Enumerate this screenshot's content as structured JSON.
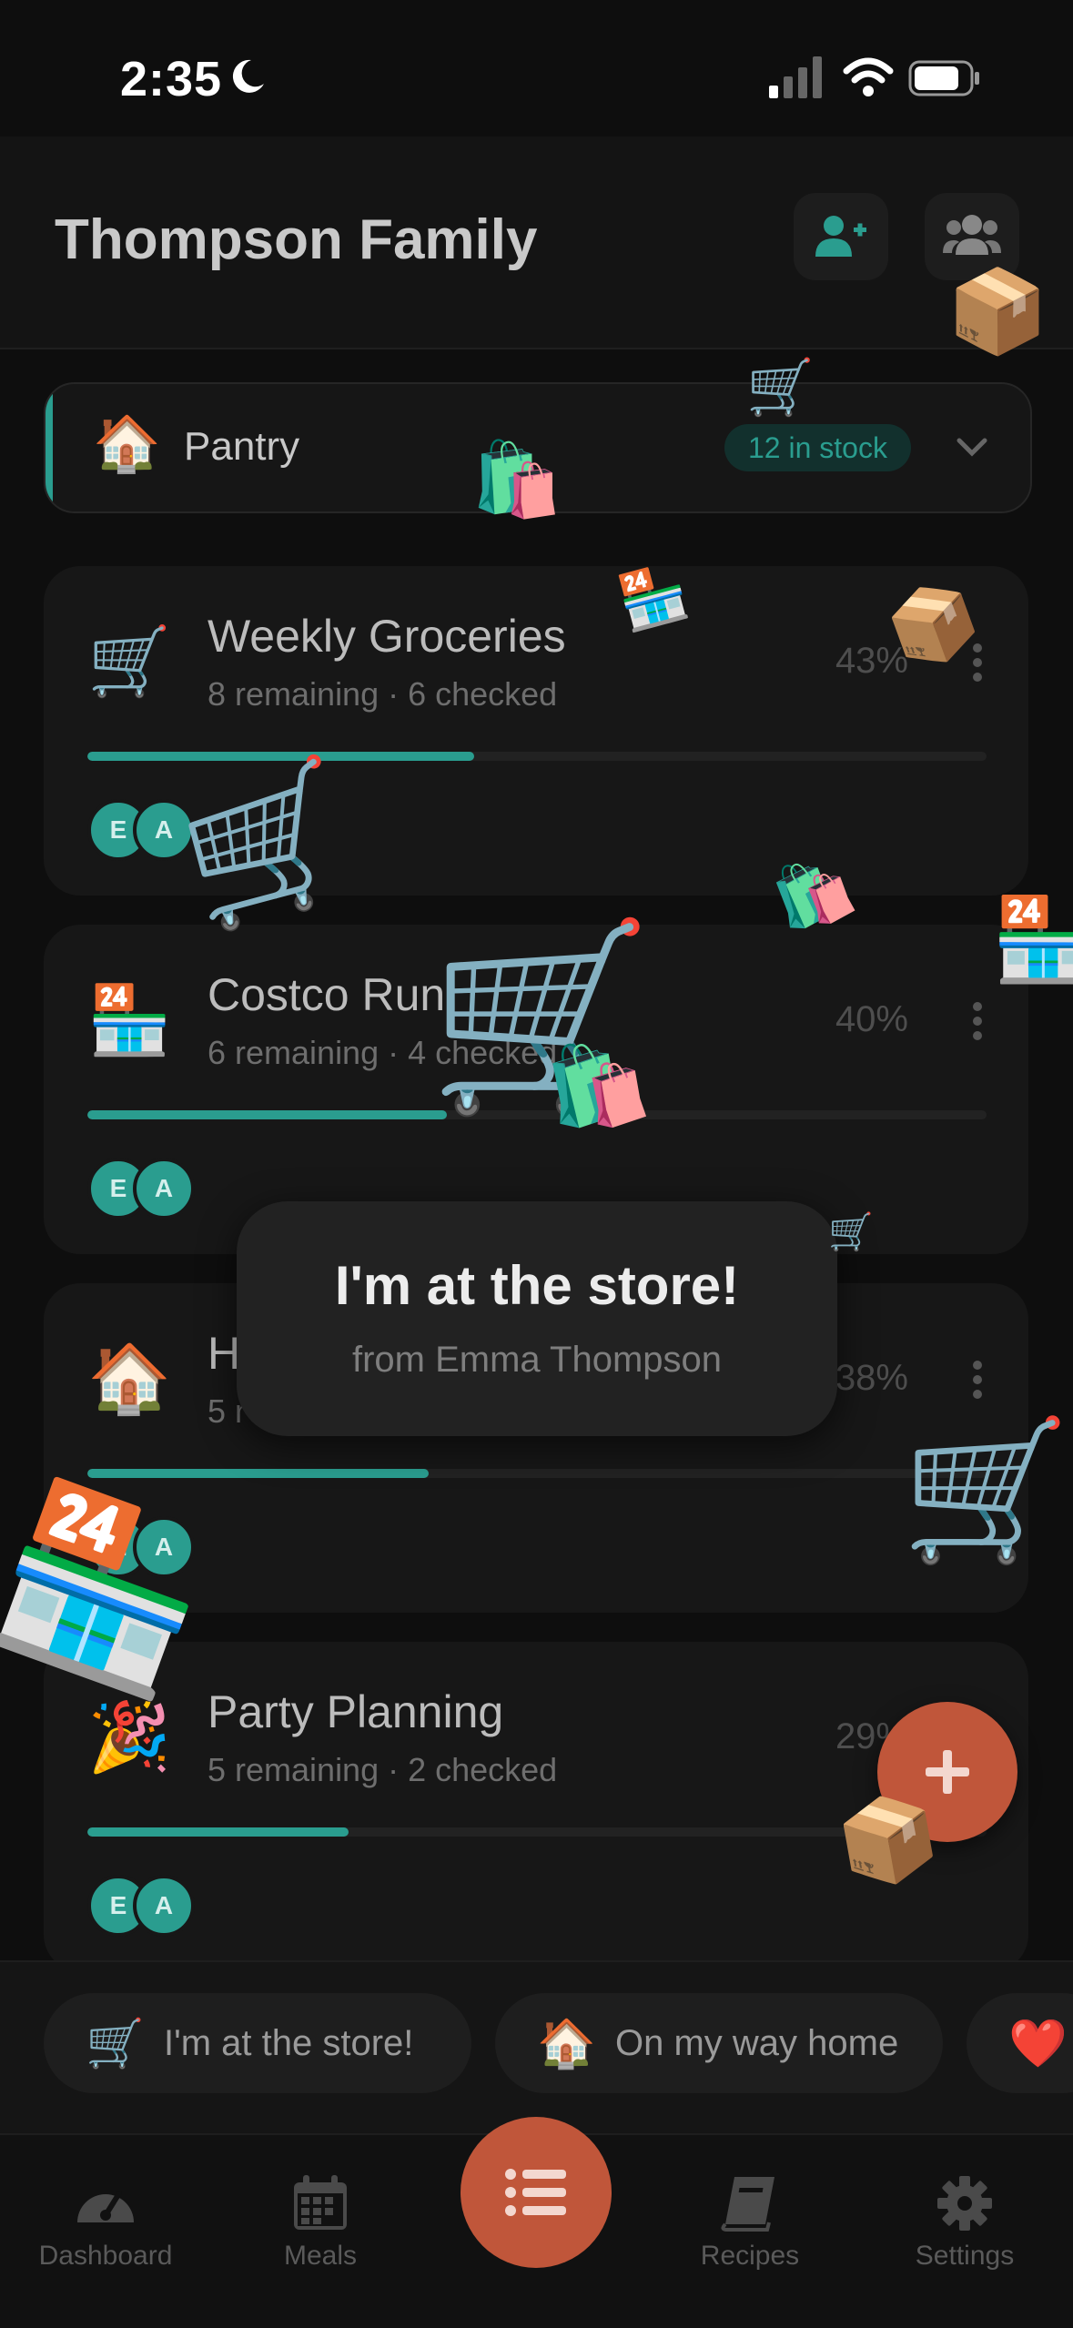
{
  "status_bar": {
    "time": "2:35",
    "icons": [
      "moon-icon",
      "signal-icon",
      "wifi-icon",
      "battery-icon"
    ]
  },
  "header": {
    "title": "Thompson Family",
    "buttons": [
      "add-member-icon",
      "group-icon"
    ]
  },
  "pantry": {
    "emoji": "🏠",
    "label": "Pantry",
    "badge": "12 in stock"
  },
  "lists": [
    {
      "emoji": "🛒",
      "name": "Weekly Groceries",
      "sub": "8 remaining · 6 checked",
      "percent": "43%",
      "progress": 0.43,
      "members": [
        "E",
        "A"
      ]
    },
    {
      "emoji": "🏪",
      "name": "Costco Run",
      "sub": "6 remaining · 4 checked",
      "percent": "40%",
      "progress": 0.4,
      "members": [
        "E",
        "A"
      ]
    },
    {
      "emoji": "🏠",
      "name": "H",
      "sub": "5 r",
      "percent": "38%",
      "progress": 0.38,
      "members": [
        "E",
        "A"
      ]
    },
    {
      "emoji": "🎉",
      "name": "Party Planning",
      "sub": "5 remaining · 2 checked",
      "percent": "29%",
      "progress": 0.29,
      "members": [
        "E",
        "A"
      ]
    }
  ],
  "toast": {
    "title": "I'm at the store!",
    "subtitle": "from Emma Thompson"
  },
  "quick_actions": [
    {
      "emoji": "🛒",
      "label": "I'm at the store!"
    },
    {
      "emoji": "🏠",
      "label": "On my way home"
    },
    {
      "emoji": "❤️",
      "label": ""
    }
  ],
  "tabs": [
    {
      "label": "Dashboard",
      "icon": "speedometer-icon"
    },
    {
      "label": "Meals",
      "icon": "calendar-icon"
    },
    {
      "label": "",
      "icon": "list-icon"
    },
    {
      "label": "Recipes",
      "icon": "book-icon"
    },
    {
      "label": "Settings",
      "icon": "gear-icon"
    }
  ],
  "colors": {
    "accent": "#2a9d8f",
    "primary": "#c0563a",
    "background": "#0e0e0e"
  },
  "confetti": [
    "📦",
    "🛒",
    "🛍️",
    "🏪",
    "📦",
    "🛒",
    "🛍️",
    "🏪",
    "🛒",
    "🛍️",
    "🛒",
    "🏪"
  ]
}
